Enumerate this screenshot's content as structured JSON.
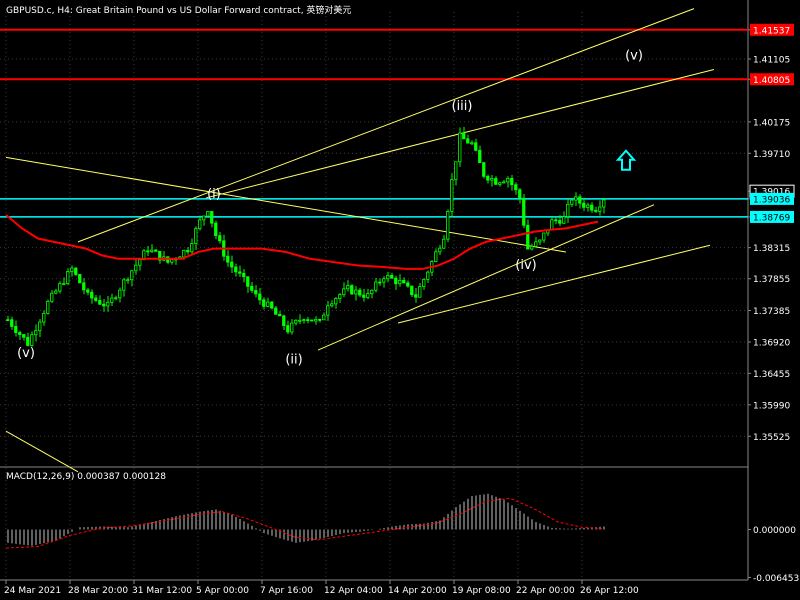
{
  "title": "GBPUSD.c, H4:  Great Britain Pound vs US Dollar Forward contract, 英镑对美元",
  "macd_title": "MACD(12,26,9) 0.000387 0.000128",
  "colors": {
    "background": "#000000",
    "grid": "#3a3a3a",
    "candle": "#00ff00",
    "ma": "#ff0000",
    "trend": "#ffff66",
    "hline_red": "#ff0000",
    "hline_cyan": "#00ffff",
    "arrow": "#00ffff",
    "label": "#ffffff",
    "macd_hist": "#c0c0c0",
    "macd_signal": "#ff0000"
  },
  "chart_data": {
    "type": "candlestick",
    "symbol": "GBPUSD.c",
    "timeframe": "H4",
    "price_ticks": [
      "1.41537",
      "1.41105",
      "1.40805",
      "1.40175",
      "1.39710",
      "1.39016",
      "1.39036",
      "1.38769",
      "1.38315",
      "1.37855",
      "1.37385",
      "1.36920",
      "1.36455",
      "1.35990",
      "1.35525"
    ],
    "price_axis_labels": [
      {
        "value": 1.41537,
        "text": "1.41537",
        "style": "red"
      },
      {
        "value": 1.41105,
        "text": "1.41105",
        "style": "plain"
      },
      {
        "value": 1.40805,
        "text": "1.40805",
        "style": "red"
      },
      {
        "value": 1.40175,
        "text": "1.40175",
        "style": "plain"
      },
      {
        "value": 1.3971,
        "text": "1.39710",
        "style": "plain"
      },
      {
        "value": 1.3915,
        "text": "1.39016",
        "style": "boxed"
      },
      {
        "value": 1.39036,
        "text": "1.39036",
        "style": "cyan"
      },
      {
        "value": 1.38769,
        "text": "1.38769",
        "style": "cyan"
      },
      {
        "value": 1.38315,
        "text": "1.38315",
        "style": "plain"
      },
      {
        "value": 1.37855,
        "text": "1.37855",
        "style": "plain"
      },
      {
        "value": 1.37385,
        "text": "1.37385",
        "style": "plain"
      },
      {
        "value": 1.3692,
        "text": "1.36920",
        "style": "plain"
      },
      {
        "value": 1.36455,
        "text": "1.36455",
        "style": "plain"
      },
      {
        "value": 1.3599,
        "text": "1.35990",
        "style": "plain"
      },
      {
        "value": 1.35525,
        "text": "1.35525",
        "style": "plain"
      }
    ],
    "ylim": [
      1.351,
      1.418
    ],
    "x_labels": [
      "24 Mar 2021",
      "28 Mar 20:00",
      "31 Mar 12:00",
      "5 Apr 00:00",
      "7 Apr 16:00",
      "12 Apr 04:00",
      "14 Apr 20:00",
      "19 Apr 08:00",
      "22 Apr 00:00",
      "26 Apr 12:00"
    ],
    "x_label_bar_index": [
      0,
      16,
      32,
      48,
      64,
      80,
      96,
      112,
      128,
      144
    ],
    "bar_count": 150,
    "close_path": [
      [
        0,
        1.3725
      ],
      [
        5,
        1.369
      ],
      [
        10,
        1.375
      ],
      [
        16,
        1.38
      ],
      [
        20,
        1.376
      ],
      [
        25,
        1.3745
      ],
      [
        30,
        1.379
      ],
      [
        35,
        1.383
      ],
      [
        40,
        1.381
      ],
      [
        45,
        1.383
      ],
      [
        48,
        1.387
      ],
      [
        50,
        1.389
      ],
      [
        52,
        1.385
      ],
      [
        55,
        1.381
      ],
      [
        58,
        1.379
      ],
      [
        62,
        1.376
      ],
      [
        66,
        1.374
      ],
      [
        70,
        1.371
      ],
      [
        74,
        1.373
      ],
      [
        78,
        1.372
      ],
      [
        80,
        1.375
      ],
      [
        85,
        1.377
      ],
      [
        90,
        1.376
      ],
      [
        94,
        1.379
      ],
      [
        98,
        1.378
      ],
      [
        102,
        1.376
      ],
      [
        106,
        1.381
      ],
      [
        109,
        1.385
      ],
      [
        111,
        1.393
      ],
      [
        113,
        1.3995
      ],
      [
        116,
        1.3985
      ],
      [
        119,
        1.394
      ],
      [
        122,
        1.393
      ],
      [
        125,
        1.3935
      ],
      [
        128,
        1.3905
      ],
      [
        130,
        1.383
      ],
      [
        133,
        1.384
      ],
      [
        136,
        1.387
      ],
      [
        139,
        1.3875
      ],
      [
        141,
        1.3905
      ],
      [
        144,
        1.3895
      ],
      [
        147,
        1.389
      ],
      [
        149,
        1.3905
      ]
    ],
    "moving_average": [
      [
        0,
        1.388
      ],
      [
        4,
        1.386
      ],
      [
        8,
        1.3845
      ],
      [
        12,
        1.384
      ],
      [
        16,
        1.3835
      ],
      [
        20,
        1.383
      ],
      [
        24,
        1.382
      ],
      [
        28,
        1.3815
      ],
      [
        32,
        1.3815
      ],
      [
        38,
        1.3815
      ],
      [
        44,
        1.3815
      ],
      [
        48,
        1.3825
      ],
      [
        52,
        1.383
      ],
      [
        58,
        1.383
      ],
      [
        64,
        1.383
      ],
      [
        70,
        1.3825
      ],
      [
        76,
        1.3815
      ],
      [
        82,
        1.381
      ],
      [
        88,
        1.3805
      ],
      [
        94,
        1.3803
      ],
      [
        100,
        1.38
      ],
      [
        104,
        1.38
      ],
      [
        108,
        1.3805
      ],
      [
        112,
        1.3815
      ],
      [
        116,
        1.383
      ],
      [
        120,
        1.384
      ],
      [
        124,
        1.3845
      ],
      [
        128,
        1.385
      ],
      [
        132,
        1.3855
      ],
      [
        136,
        1.3858
      ],
      [
        140,
        1.386
      ],
      [
        144,
        1.3865
      ],
      [
        148,
        1.387
      ]
    ],
    "horizontal_lines": [
      {
        "price": 1.41537,
        "color": "red"
      },
      {
        "price": 1.40805,
        "color": "red"
      },
      {
        "price": 1.39036,
        "color": "cyan"
      },
      {
        "price": 1.38769,
        "color": "cyan"
      }
    ],
    "trend_lines": [
      {
        "from": [
          0,
          1.3965
        ],
        "to": [
          140,
          1.3825
        ]
      },
      {
        "from": [
          18,
          1.384
        ],
        "to": [
          172,
          1.4185
        ]
      },
      {
        "from": [
          50,
          1.3905
        ],
        "to": [
          177,
          1.4095
        ]
      },
      {
        "from": [
          78,
          1.368
        ],
        "to": [
          162,
          1.3895
        ]
      },
      {
        "from": [
          98,
          1.372
        ],
        "to": [
          176,
          1.3835
        ]
      },
      {
        "from": [
          0,
          1.356
        ],
        "to": [
          18,
          1.35
        ]
      }
    ],
    "wave_labels": [
      {
        "text": "(v)",
        "bar": 5,
        "price": 1.367
      },
      {
        "text": "(i)",
        "bar": 52,
        "price": 1.3905
      },
      {
        "text": "(ii)",
        "bar": 72,
        "price": 1.366
      },
      {
        "text": "(iii)",
        "bar": 114,
        "price": 1.4035
      },
      {
        "text": "(iv)",
        "bar": 130,
        "price": 1.38
      },
      {
        "text": "(v)",
        "bar": 157,
        "price": 1.411
      }
    ],
    "arrow": {
      "direction": "up",
      "bar": 155,
      "price": 1.396
    },
    "macd": {
      "ticks": [
        "0.000000",
        "-0.006453"
      ],
      "ylim": [
        -0.0068,
        0.008
      ],
      "histogram_path": [
        [
          0,
          -0.0018
        ],
        [
          6,
          -0.0022
        ],
        [
          12,
          -0.0015
        ],
        [
          18,
          0.0003
        ],
        [
          24,
          0.0004
        ],
        [
          30,
          0.0003
        ],
        [
          36,
          0.001
        ],
        [
          42,
          0.0018
        ],
        [
          48,
          0.0024
        ],
        [
          52,
          0.0027
        ],
        [
          56,
          0.002
        ],
        [
          60,
          0.0008
        ],
        [
          64,
          -0.0005
        ],
        [
          68,
          -0.0012
        ],
        [
          72,
          -0.0018
        ],
        [
          76,
          -0.0015
        ],
        [
          80,
          -0.001
        ],
        [
          84,
          -0.0005
        ],
        [
          88,
          -0.0003
        ],
        [
          92,
          0.0
        ],
        [
          96,
          0.0004
        ],
        [
          100,
          0.0007
        ],
        [
          104,
          0.0008
        ],
        [
          108,
          0.0012
        ],
        [
          112,
          0.003
        ],
        [
          116,
          0.0045
        ],
        [
          120,
          0.0048
        ],
        [
          124,
          0.004
        ],
        [
          128,
          0.0025
        ],
        [
          132,
          0.001
        ],
        [
          136,
          0.0002
        ],
        [
          140,
          0.0001
        ],
        [
          144,
          0.0002
        ],
        [
          149,
          0.0004
        ]
      ],
      "signal_path": [
        [
          0,
          -0.0025
        ],
        [
          8,
          -0.0023
        ],
        [
          16,
          -0.0008
        ],
        [
          24,
          0.0002
        ],
        [
          32,
          0.0005
        ],
        [
          40,
          0.0012
        ],
        [
          48,
          0.002
        ],
        [
          54,
          0.0024
        ],
        [
          60,
          0.0015
        ],
        [
          66,
          0.0003
        ],
        [
          72,
          -0.001
        ],
        [
          78,
          -0.0014
        ],
        [
          86,
          -0.0008
        ],
        [
          94,
          -0.0002
        ],
        [
          102,
          0.0004
        ],
        [
          108,
          0.0009
        ],
        [
          114,
          0.0022
        ],
        [
          120,
          0.0038
        ],
        [
          126,
          0.0042
        ],
        [
          132,
          0.0028
        ],
        [
          138,
          0.001
        ],
        [
          144,
          0.0003
        ],
        [
          149,
          0.0001
        ]
      ]
    }
  }
}
